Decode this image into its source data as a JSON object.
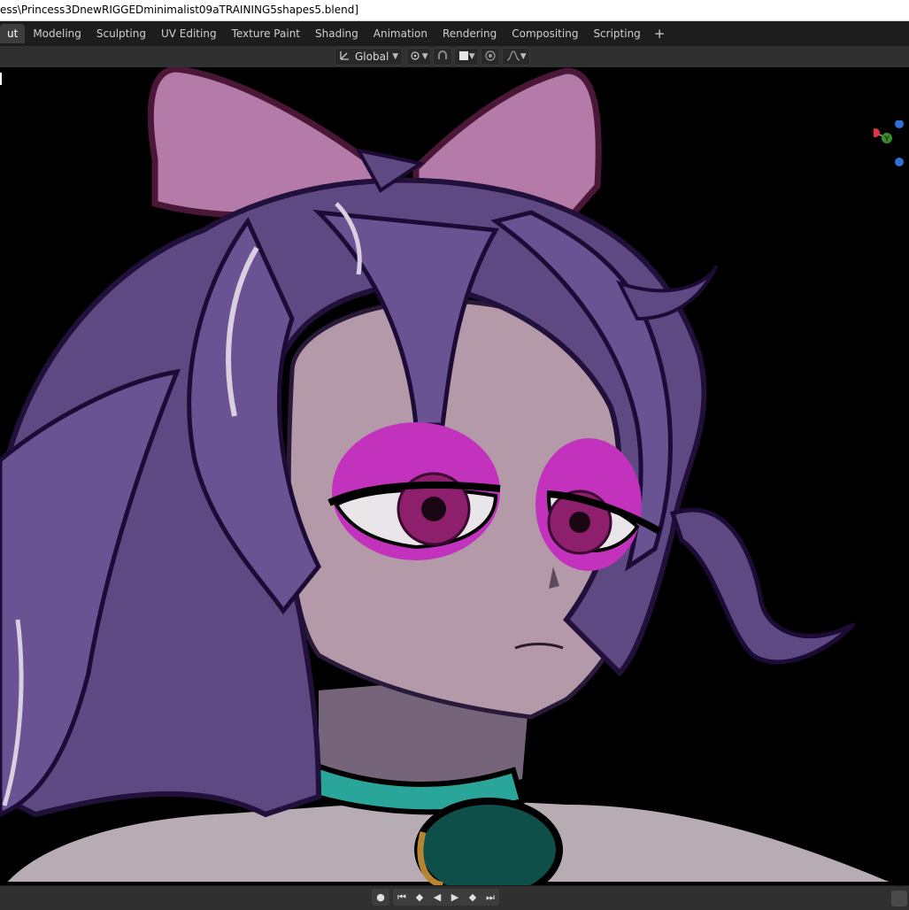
{
  "window": {
    "title": "ess\\Princess3DnewRIGGEDminimalist09aTRAINING5shapes5.blend]"
  },
  "workspaces": {
    "tabs": [
      {
        "label": "ut",
        "active": true
      },
      {
        "label": "Modeling",
        "active": false
      },
      {
        "label": "Sculpting",
        "active": false
      },
      {
        "label": "UV Editing",
        "active": false
      },
      {
        "label": "Texture Paint",
        "active": false
      },
      {
        "label": "Shading",
        "active": false
      },
      {
        "label": "Animation",
        "active": false
      },
      {
        "label": "Rendering",
        "active": false
      },
      {
        "label": "Compositing",
        "active": false
      },
      {
        "label": "Scripting",
        "active": false
      }
    ],
    "add_label": "+"
  },
  "header": {
    "orientation_label": "Global",
    "icons": [
      "transform-orientation-icon",
      "pivot-point-icon",
      "snap-icon",
      "snap-target-icon",
      "proportional-edit-icon",
      "falloff-icon"
    ]
  },
  "viewport": {
    "gizmo_axis_label": "Y",
    "colors": {
      "background": "#000000",
      "hair": "#5e4983",
      "skin": "#b49aa8",
      "bow": "#b57ba8",
      "eyeshadow": "#c232bd",
      "iris": "#8e1f6d",
      "collar": "#2aa59a",
      "gem": "#0e5049"
    }
  },
  "timeline": {
    "record_icon": "●",
    "jump_start_icon": "⏮",
    "prev_key_icon": "◆",
    "play_reverse_icon": "◀",
    "play_icon": "▶",
    "next_key_icon": "◆",
    "jump_end_icon": "⏭"
  }
}
